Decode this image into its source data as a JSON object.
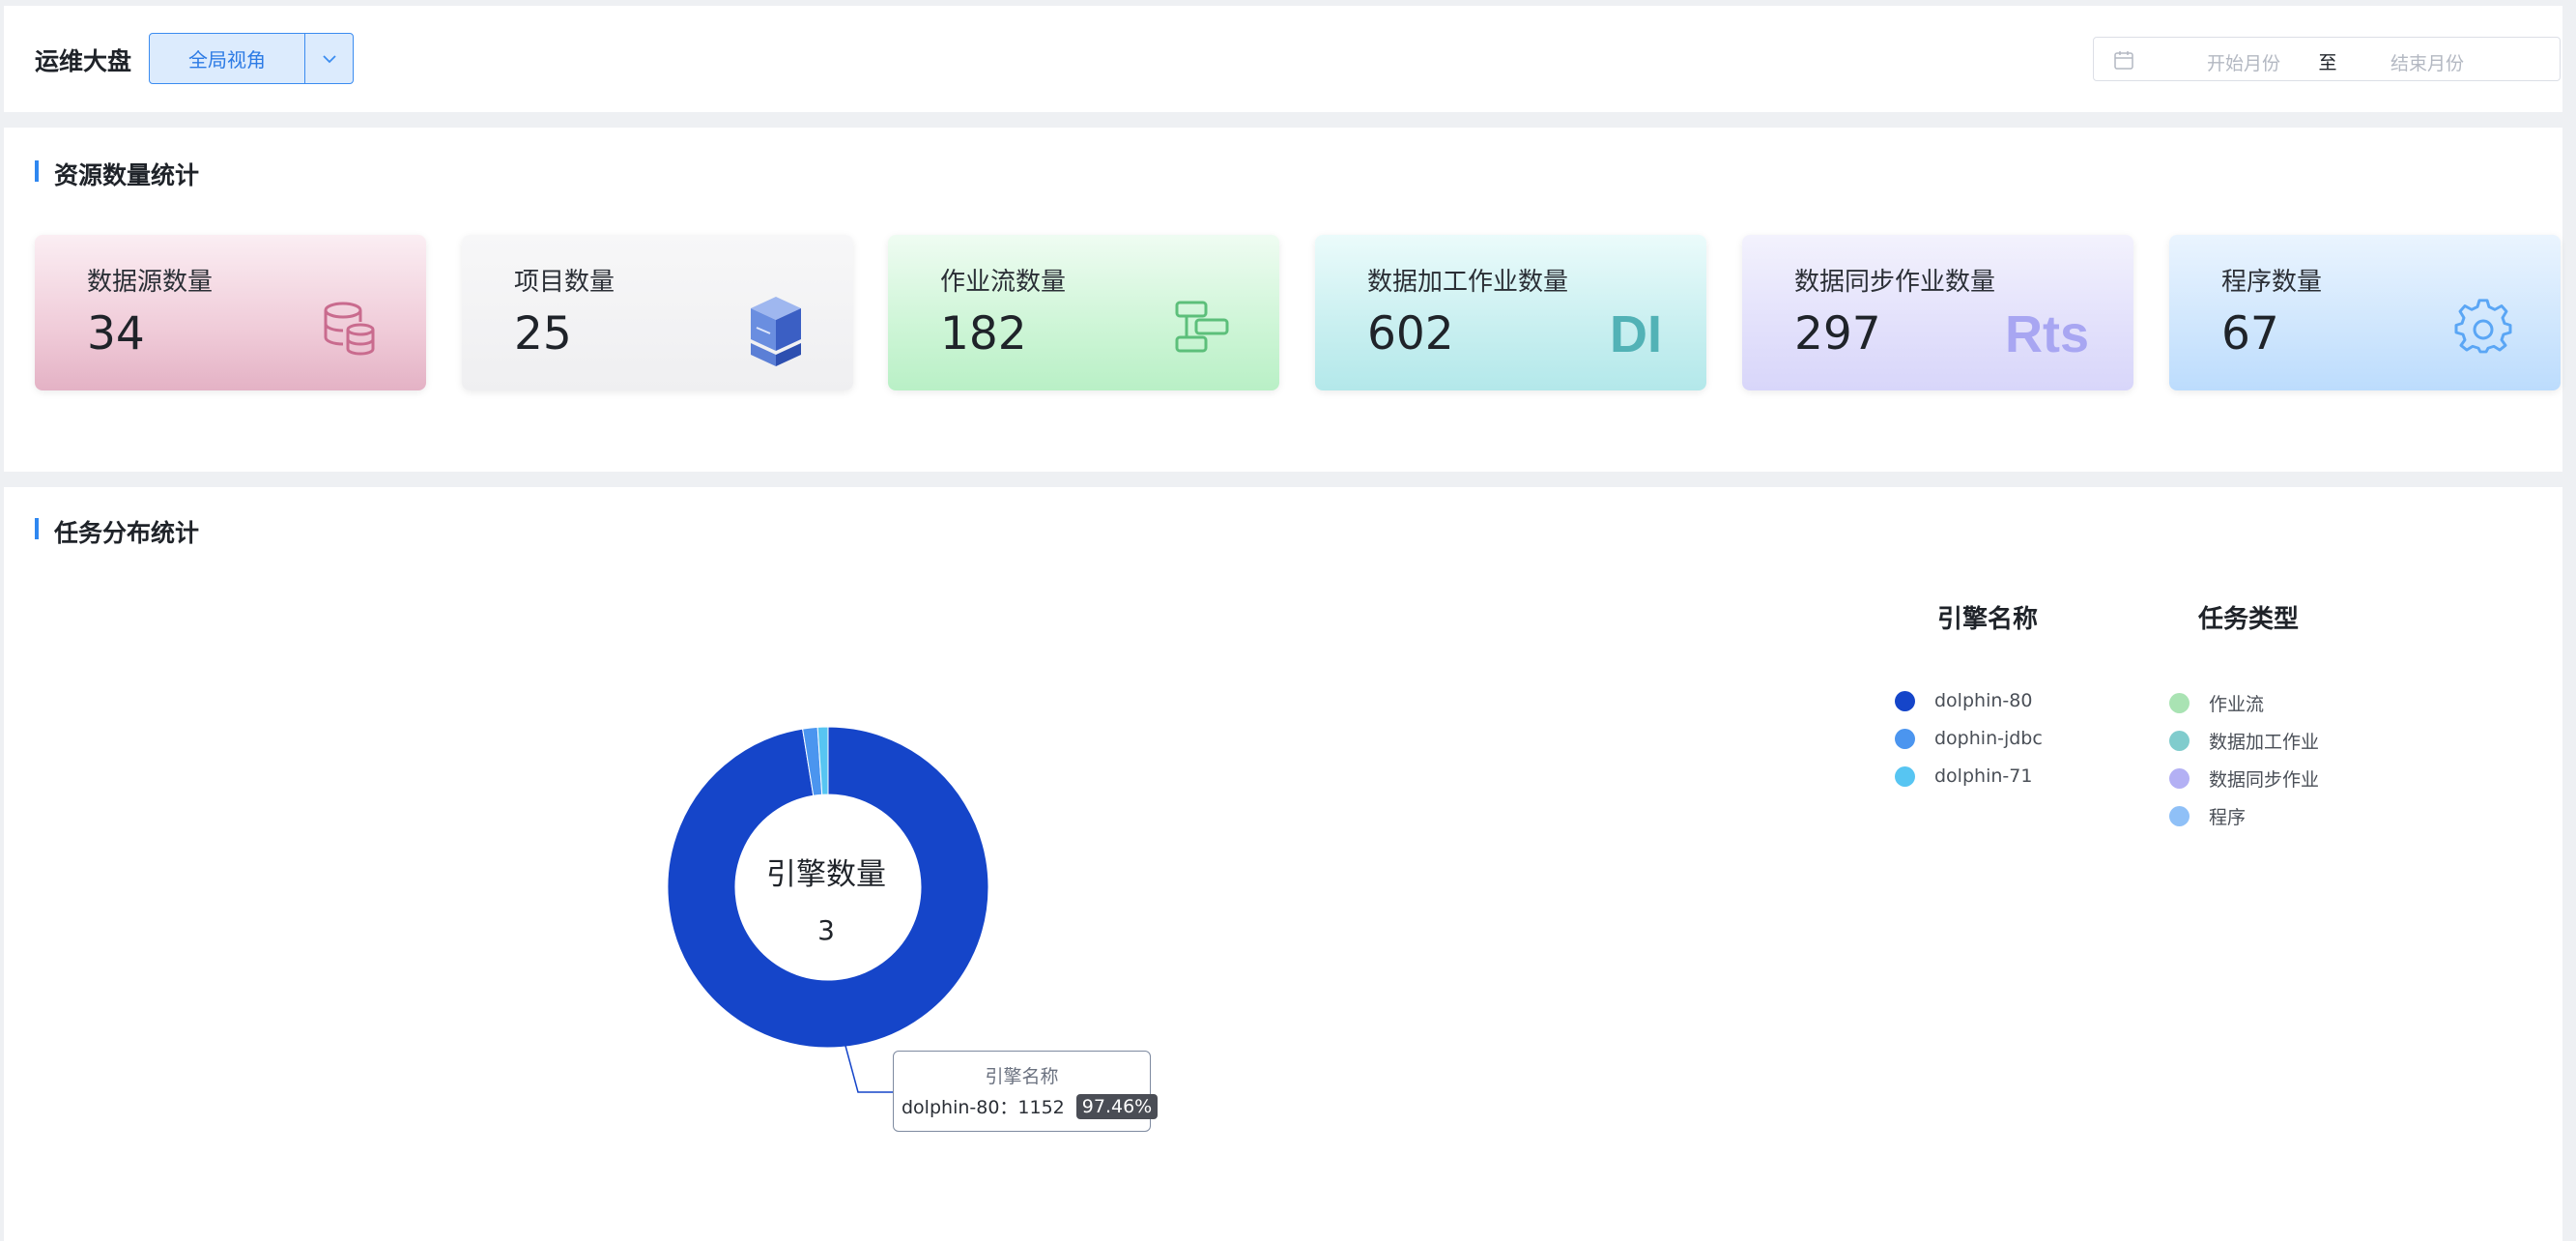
{
  "header": {
    "title": "运维大盘",
    "view_selector": {
      "value": "全局视角"
    },
    "date_range": {
      "start_placeholder": "开始月份",
      "separator": "至",
      "end_placeholder": "结束月份"
    }
  },
  "resource_section": {
    "title": "资源数量统计",
    "cards": [
      {
        "label": "数据源数量",
        "value": "34",
        "icon": "database-icon",
        "color": "#c96b8e"
      },
      {
        "label": "项目数量",
        "value": "25",
        "icon": "server-cube-icon",
        "color": "#3b5fc4"
      },
      {
        "label": "作业流数量",
        "value": "182",
        "icon": "workflow-icon",
        "color": "#5cbf7a"
      },
      {
        "label": "数据加工作业数量",
        "value": "602",
        "icon": "DI",
        "color": "#52b2b6"
      },
      {
        "label": "数据同步作业数量",
        "value": "297",
        "icon": "Rts",
        "color": "#a8a6f2"
      },
      {
        "label": "程序数量",
        "value": "67",
        "icon": "gear-icon",
        "color": "#5aa6f5"
      }
    ]
  },
  "task_section": {
    "title": "任务分布统计",
    "donut": {
      "center_label": "引擎数量",
      "center_value": "3"
    },
    "tooltip": {
      "title": "引擎名称",
      "row": "dolphin-80：1152",
      "percent": "97.46%"
    },
    "engine_legend": {
      "title": "引擎名称",
      "items": [
        {
          "label": "dolphin-80",
          "color": "#1545c9"
        },
        {
          "label": "dophin-jdbc",
          "color": "#4b95ef"
        },
        {
          "label": "dolphin-71",
          "color": "#57c5f2"
        }
      ]
    },
    "type_legend": {
      "title": "任务类型",
      "items": [
        {
          "label": "作业流",
          "color": "#a9e3b3"
        },
        {
          "label": "数据加工作业",
          "color": "#80cccd"
        },
        {
          "label": "数据同步作业",
          "color": "#b3b0f4"
        },
        {
          "label": "程序",
          "color": "#8fc0f7"
        }
      ]
    }
  },
  "chart_data": {
    "type": "pie",
    "categories": [
      "dolphin-80",
      "dophin-jdbc",
      "dolphin-71"
    ],
    "values": [
      97.46,
      1.5,
      1.04
    ],
    "colors": [
      "#1545c9",
      "#4b95ef",
      "#57c5f2"
    ]
  }
}
